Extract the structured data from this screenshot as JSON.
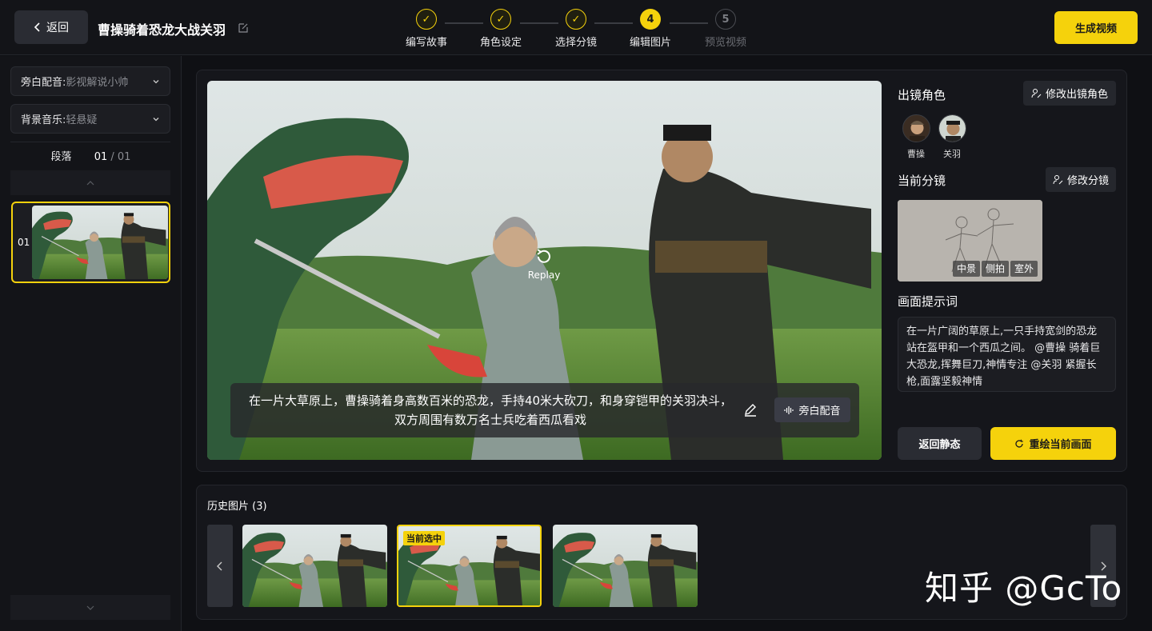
{
  "header": {
    "back_label": "返回",
    "project_title": "曹操骑着恐龙大战关羽",
    "steps": [
      {
        "num": "1",
        "label": "编写故事",
        "state": "done"
      },
      {
        "num": "2",
        "label": "角色设定",
        "state": "done"
      },
      {
        "num": "3",
        "label": "选择分镜",
        "state": "done"
      },
      {
        "num": "4",
        "label": "编辑图片",
        "state": "active"
      },
      {
        "num": "5",
        "label": "预览视频",
        "state": "todo"
      }
    ],
    "generate_label": "生成视频"
  },
  "sidebar": {
    "narration_key": "旁白配音:",
    "narration_value": "影视解说小帅",
    "music_key": "背景音乐:",
    "music_value": "轻悬疑",
    "segment_label": "段落",
    "segment_current": "01",
    "segment_total": "/ 01",
    "paragraph_items": [
      {
        "num": "01"
      }
    ]
  },
  "player": {
    "replay_label": "Replay",
    "caption": "在一片大草原上，曹操骑着身高数百米的恐龙，手持40米大砍刀，和身穿铠甲的关羽决斗，双方周围有数万名士兵吃着西瓜看戏",
    "narration_button": "旁白配音"
  },
  "right": {
    "characters_title": "出镜角色",
    "edit_characters_label": "修改出镜角色",
    "characters": [
      "曹操",
      "关羽"
    ],
    "storyboard_title": "当前分镜",
    "edit_storyboard_label": "修改分镜",
    "storyboard_tags": [
      "中景",
      "侧拍",
      "室外"
    ],
    "prompt_title": "画面提示词",
    "prompt_text": "在一片广阔的草原上,一只手持宽剑的恐龙站在盔甲和一个西瓜之间。 @曹操 骑着巨大恐龙,挥舞巨刀,神情专注 @关羽 紧握长枪,面露坚毅神情",
    "back_static_label": "返回静态",
    "redraw_label": "重绘当前画面"
  },
  "history": {
    "title": "历史图片 (3)",
    "current_badge": "当前选中",
    "images": [
      {
        "selected": false
      },
      {
        "selected": true
      },
      {
        "selected": false
      }
    ]
  },
  "watermark": "知乎 @GcTo",
  "colors": {
    "accent": "#f5d20c",
    "background": "#0f1014",
    "panel": "#15161b"
  }
}
